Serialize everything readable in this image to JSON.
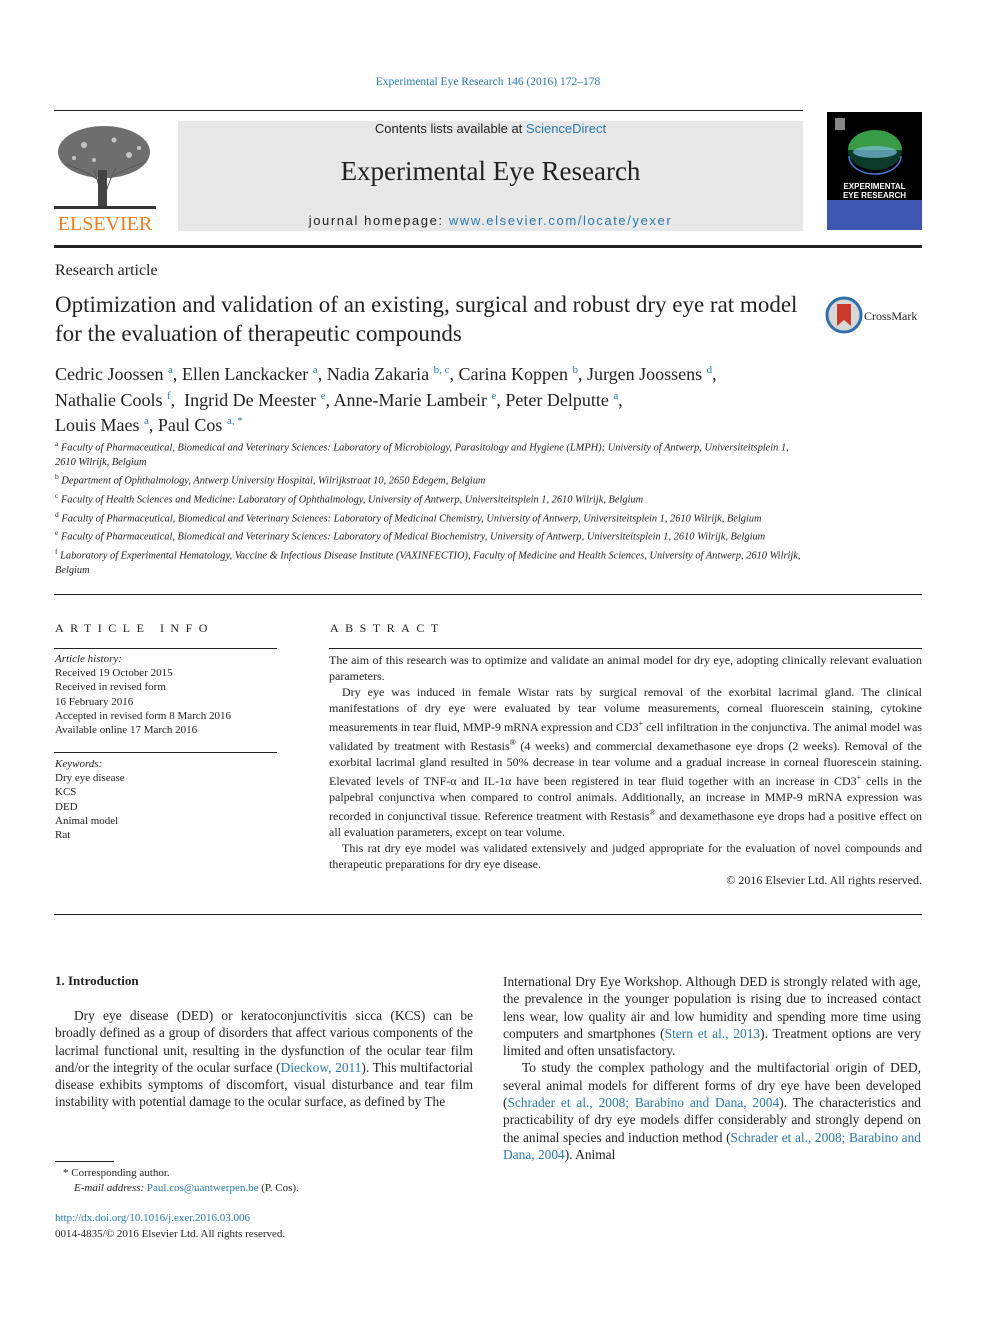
{
  "journal_ref": "Experimental Eye Research 146 (2016) 172–178",
  "masthead": {
    "contents_prefix": "Contents lists available at ",
    "contents_link": "ScienceDirect",
    "journal_title": "Experimental Eye Research",
    "homepage_prefix": "journal homepage: ",
    "homepage_link": "www.elsevier.com/locate/yexer",
    "publisher_logo_text": "ELSEVIER",
    "cover_title_line1": "EXPERIMENTAL",
    "cover_title_line2": "EYE RESEARCH",
    "colors": {
      "elsevier_orange": "#f07d1a",
      "link_blue": "#2a7ab0",
      "masthead_gray": "#e8e8e8",
      "cover_band_blue": "#3d57b0"
    }
  },
  "article": {
    "type": "Research article",
    "title": "Optimization and validation of an existing, surgical and robust dry eye rat model for the evaluation of therapeutic compounds",
    "crossmark_label": "CrossMark",
    "authors": [
      {
        "name": "Cedric Joossen",
        "aff": "a"
      },
      {
        "name": "Ellen Lanckacker",
        "aff": "a"
      },
      {
        "name": "Nadia Zakaria",
        "aff": "b, c"
      },
      {
        "name": "Carina Koppen",
        "aff": "b"
      },
      {
        "name": "Jurgen Joossens",
        "aff": "d"
      },
      {
        "name": "Nathalie Cools",
        "aff": "f"
      },
      {
        "name": "Ingrid De Meester",
        "aff": "e"
      },
      {
        "name": "Anne-Marie Lambeir",
        "aff": "e"
      },
      {
        "name": "Peter Delputte",
        "aff": "a"
      },
      {
        "name": "Louis Maes",
        "aff": "a"
      },
      {
        "name": "Paul Cos",
        "aff": "a, *"
      }
    ],
    "affiliations": [
      {
        "key": "a",
        "text": "Faculty of Pharmaceutical, Biomedical and Veterinary Sciences: Laboratory of Microbiology, Parasitology and Hygiene (LMPH); University of Antwerp, Universiteitsplein 1, 2610 Wilrijk, Belgium"
      },
      {
        "key": "b",
        "text": "Department of Ophthalmology, Antwerp University Hospital, Wilrijkstraat 10, 2650 Edegem, Belgium"
      },
      {
        "key": "c",
        "text": "Faculty of Health Sciences and Medicine: Laboratory of Ophthalmology, University of Antwerp, Universiteitsplein 1, 2610 Wilrijk, Belgium"
      },
      {
        "key": "d",
        "text": "Faculty of Pharmaceutical, Biomedical and Veterinary Sciences: Laboratory of Medicinal Chemistry, University of Antwerp, Universiteitsplein 1, 2610 Wilrijk, Belgium"
      },
      {
        "key": "e",
        "text": "Faculty of Pharmaceutical, Biomedical and Veterinary Sciences: Laboratory of Medical Biochemistry, University of Antwerp, Universiteitsplein 1, 2610 Wilrijk, Belgium"
      },
      {
        "key": "f",
        "text": "Laboratory of Experimental Hematology, Vaccine & Infectious Disease Institute (VAXINFECTIO), Faculty of Medicine and Health Sciences, University of Antwerp, 2610 Wilrijk, Belgium"
      }
    ]
  },
  "article_info": {
    "heading": "ARTICLE INFO",
    "history_label": "Article history:",
    "history": [
      "Received 19 October 2015",
      "Received in revised form",
      "16 February 2016",
      "Accepted in revised form 8 March 2016",
      "Available online 17 March 2016"
    ],
    "keywords_label": "Keywords:",
    "keywords": [
      "Dry eye disease",
      "KCS",
      "DED",
      "Animal model",
      "Rat"
    ]
  },
  "abstract": {
    "heading": "ABSTRACT",
    "p1": "The aim of this research was to optimize and validate an animal model for dry eye, adopting clinically relevant evaluation parameters.",
    "p2_a": "Dry eye was induced in female Wistar rats by surgical removal of the exorbital lacrimal gland. The clinical manifestations of dry eye were evaluated by tear volume measurements, corneal fluorescein staining, cytokine measurements in tear fluid, MMP-9 mRNA expression and CD3",
    "p2_b": " cell infiltration in the conjunctiva. The animal model was validated by treatment with Restasis",
    "p2_c": " (4 weeks) and commercial dexamethasone eye drops (2 weeks). Removal of the exorbital lacrimal gland resulted in 50% decrease in tear volume and a gradual increase in corneal fluorescein staining. Elevated levels of TNF-α and IL-1α have been registered in tear fluid together with an increase in CD3",
    "p2_d": " cells in the palpebral conjunctiva when compared to control animals. Additionally, an increase in MMP-9 mRNA expression was recorded in conjunctival tissue. Reference treatment with Restasis",
    "p2_e": " and dexamethasone eye drops had a positive effect on all evaluation parameters, except on tear volume.",
    "p3": "This rat dry eye model was validated extensively and judged appropriate for the evaluation of novel compounds and therapeutic preparations for dry eye disease.",
    "sup_plus": "+",
    "sup_reg": "®",
    "copyright": "© 2016 Elsevier Ltd. All rights reserved."
  },
  "introduction": {
    "heading": "1.  Introduction",
    "c1_p1_a": "Dry eye disease (DED) or keratoconjunctivitis sicca (KCS) can be broadly defined as a group of disorders that affect various components of the lacrimal functional unit, resulting in the dysfunction of the ocular tear film and/or the integrity of the ocular surface (",
    "c1_p1_link": "Dieckow, 2011",
    "c1_p1_b": "). This multifactorial disease exhibits symptoms of discomfort, visual disturbance and tear film instability with potential damage to the ocular surface, as defined by The",
    "c2_p1_a": "International Dry Eye Workshop. Although DED is strongly related with age, the prevalence in the younger population is rising due to increased contact lens wear, low quality air and low humidity and spending more time using computers and smartphones (",
    "c2_p1_link": "Stern et al., 2013",
    "c2_p1_b": "). Treatment options are very limited and often unsatisfactory.",
    "c2_p2_a": "To study the complex pathology and the multifactorial origin of DED, several animal models for different forms of dry eye have been developed (",
    "c2_p2_link1": "Schrader et al., 2008; Barabino and Dana, 2004",
    "c2_p2_b": "). The characteristics and practicability of dry eye models differ considerably and strongly depend on the animal species and induction method (",
    "c2_p2_link2": "Schrader et al., 2008; Barabino and Dana, 2004",
    "c2_p2_c": "). Animal"
  },
  "footnotes": {
    "corresponding": "*  Corresponding author.",
    "email_label": "E-mail address: ",
    "email": "Paul.cos@uantwerpen.be",
    "email_suffix": " (P. Cos).",
    "doi": "http://dx.doi.org/10.1016/j.exer.2016.03.006",
    "issn_line": "0014-4835/© 2016 Elsevier Ltd. All rights reserved."
  }
}
